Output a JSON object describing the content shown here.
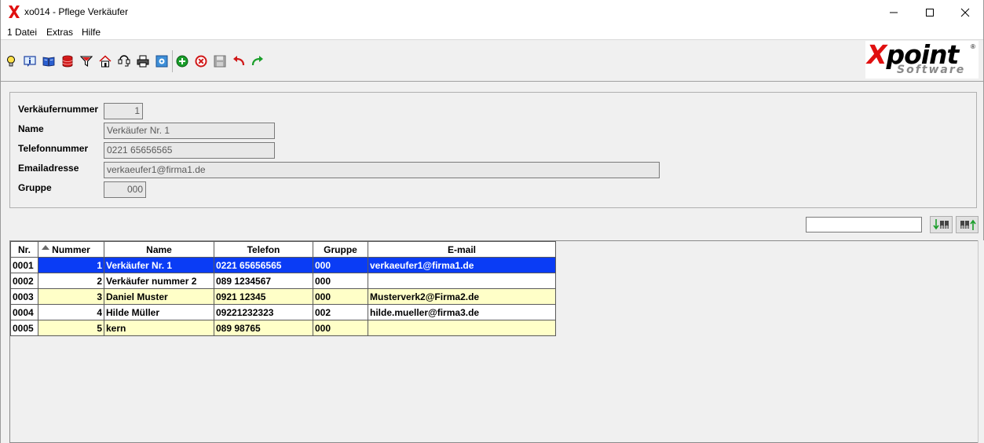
{
  "window": {
    "title": "xo014 - Pflege Verkäufer"
  },
  "menu": {
    "items": [
      "1 Datei",
      "Extras",
      "Hilfe"
    ]
  },
  "toolbar": {
    "icons": [
      "lightbulb-icon",
      "info-icon",
      "book-icon",
      "database-icon",
      "filter-icon",
      "home-icon",
      "connect-icon",
      "print-icon",
      "screen-icon",
      "add-icon",
      "delete-icon",
      "save-icon",
      "undo-icon",
      "redo-icon"
    ]
  },
  "logo": {
    "main_x": "X",
    "main_rest": "point",
    "sub": "Software",
    "reg": "®"
  },
  "form": {
    "verkaeufernummer_label": "Verkäufernummer",
    "verkaeufernummer_value": "1",
    "name_label": "Name",
    "name_value": "Verkäufer Nr. 1",
    "telefon_label": "Telefonnummer",
    "telefon_value": "0221 65656565",
    "email_label": "Emailadresse",
    "email_value": "verkaeufer1@firma1.de",
    "gruppe_label": "Gruppe",
    "gruppe_value": "000"
  },
  "search": {
    "value": ""
  },
  "grid": {
    "columns": [
      "Nr.",
      "Nummer",
      "Name",
      "Telefon",
      "Gruppe",
      "E-mail"
    ],
    "rows": [
      {
        "nr": "0001",
        "nummer": "1",
        "name": "Verkäufer Nr. 1",
        "telefon": "0221 65656565",
        "gruppe": "000",
        "email": "verkaeufer1@firma1.de",
        "style": "sel"
      },
      {
        "nr": "0002",
        "nummer": "2",
        "name": "Verkäufer nummer 2",
        "telefon": "089 1234567",
        "gruppe": "000",
        "email": "",
        "style": "white"
      },
      {
        "nr": "0003",
        "nummer": "3",
        "name": "Daniel Muster",
        "telefon": "0921 12345",
        "gruppe": "000",
        "email": "Musterverk2@Firma2.de",
        "style": "yellow"
      },
      {
        "nr": "0004",
        "nummer": "4",
        "name": "Hilde Müller",
        "telefon": "09221232323",
        "gruppe": "002",
        "email": "hilde.mueller@firma3.de",
        "style": "white"
      },
      {
        "nr": "0005",
        "nummer": "5",
        "name": "kern",
        "telefon": "089 98765",
        "gruppe": "000",
        "email": "",
        "style": "yellow"
      }
    ]
  },
  "colors": {
    "selection": "#0a3cf5",
    "alt_row": "#ffffc8",
    "logo_red": "#e01010"
  }
}
